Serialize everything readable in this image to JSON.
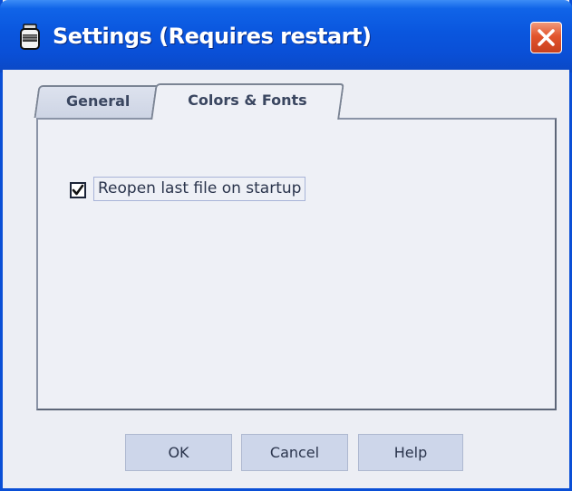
{
  "window": {
    "title": "Settings (Requires restart)",
    "title_icon": "app-jar-icon",
    "close_icon": "close-icon"
  },
  "tabs": [
    {
      "label": "General",
      "selected": false
    },
    {
      "label": "Colors & Fonts",
      "selected": true
    }
  ],
  "general_panel": {
    "reopen_checkbox": {
      "label": "Reopen last file on startup",
      "checked": true
    }
  },
  "buttons": {
    "ok": "OK",
    "cancel": "Cancel",
    "help": "Help"
  },
  "colors": {
    "titlebar": "#0a4fd6",
    "close_button": "#e2542c",
    "dialog_background": "#eceef4",
    "button_background": "#cdd6ea"
  }
}
